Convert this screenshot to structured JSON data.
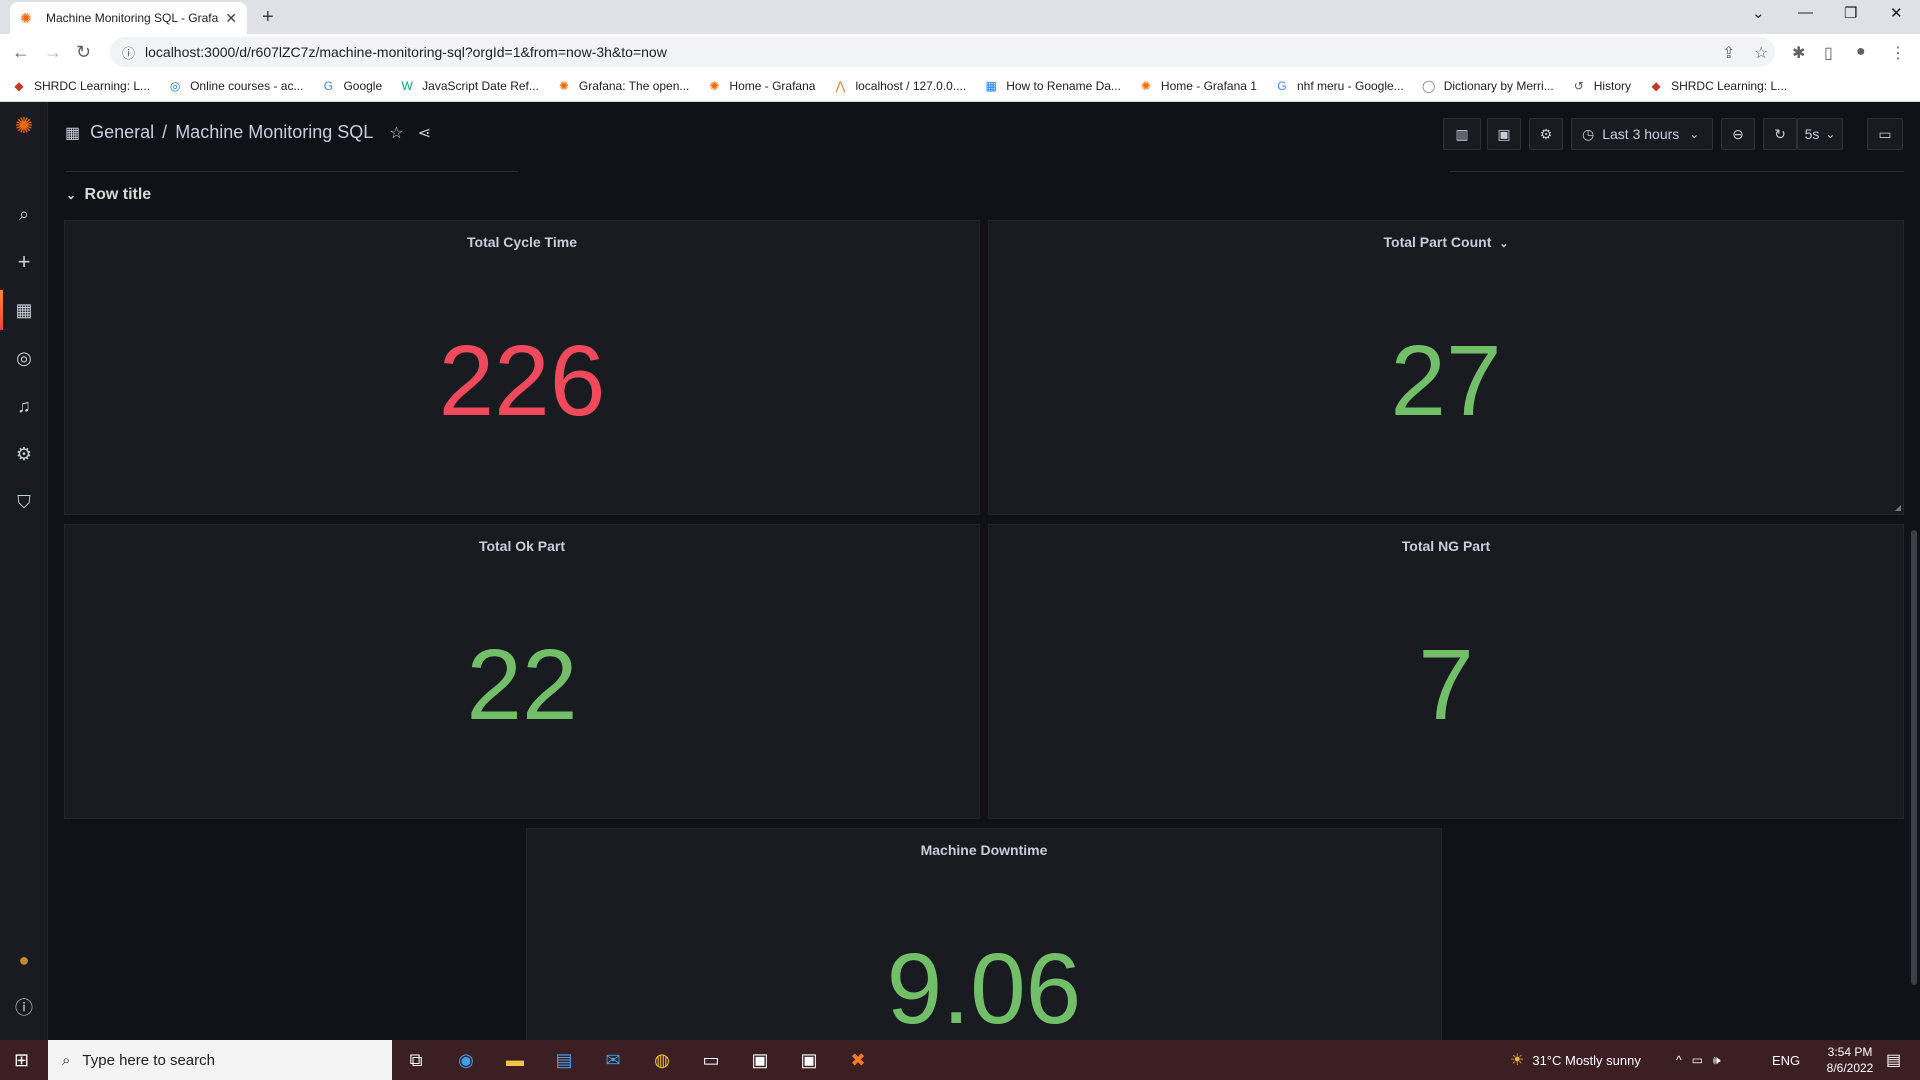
{
  "browser": {
    "tab_title": "Machine Monitoring SQL - Grafa",
    "url": "localhost:3000/d/r607lZC7z/machine-monitoring-sql?orgId=1&from=now-3h&to=now",
    "bookmarks": [
      {
        "label": "SHRDC Learning: L...",
        "icon": "shrdc-icon"
      },
      {
        "label": "Online courses - ac...",
        "icon": "globe-icon"
      },
      {
        "label": "Google",
        "icon": "google-icon"
      },
      {
        "label": "JavaScript Date Ref...",
        "icon": "w3-icon"
      },
      {
        "label": "Grafana: The open...",
        "icon": "grafana-icon"
      },
      {
        "label": "Home - Grafana",
        "icon": "grafana-icon"
      },
      {
        "label": "localhost / 127.0.0....",
        "icon": "phpmyadmin-icon"
      },
      {
        "label": "How to Rename Da...",
        "icon": "grid-icon"
      },
      {
        "label": "Home - Grafana 1",
        "icon": "grafana-icon"
      },
      {
        "label": "nhf meru - Google...",
        "icon": "google-icon"
      },
      {
        "label": "Dictionary by Merri...",
        "icon": "mw-icon"
      },
      {
        "label": "History",
        "icon": "history-icon"
      },
      {
        "label": "SHRDC Learning: L...",
        "icon": "shrdc-icon"
      }
    ]
  },
  "grafana": {
    "breadcrumb_folder": "General",
    "breadcrumb_separator": "/",
    "dashboard_title": "Machine Monitoring SQL",
    "time_range": "Last 3 hours",
    "refresh_interval": "5s",
    "row_title": "Row title",
    "panels": {
      "total_cycle_time": {
        "title": "Total Cycle Time",
        "value": "226",
        "color": "#f2495c"
      },
      "total_part_count": {
        "title": "Total Part Count",
        "value": "27",
        "color": "#73bf69"
      },
      "total_ok_part": {
        "title": "Total Ok Part",
        "value": "22",
        "color": "#73bf69"
      },
      "total_ng_part": {
        "title": "Total NG Part",
        "value": "7",
        "color": "#73bf69"
      },
      "machine_downtime": {
        "title": "Machine Downtime",
        "value": "9.06",
        "color": "#73bf69"
      }
    }
  },
  "taskbar": {
    "search_placeholder": "Type here to search",
    "weather": "31°C  Mostly sunny",
    "language": "ENG",
    "time": "3:54 PM",
    "date": "8/6/2022"
  }
}
